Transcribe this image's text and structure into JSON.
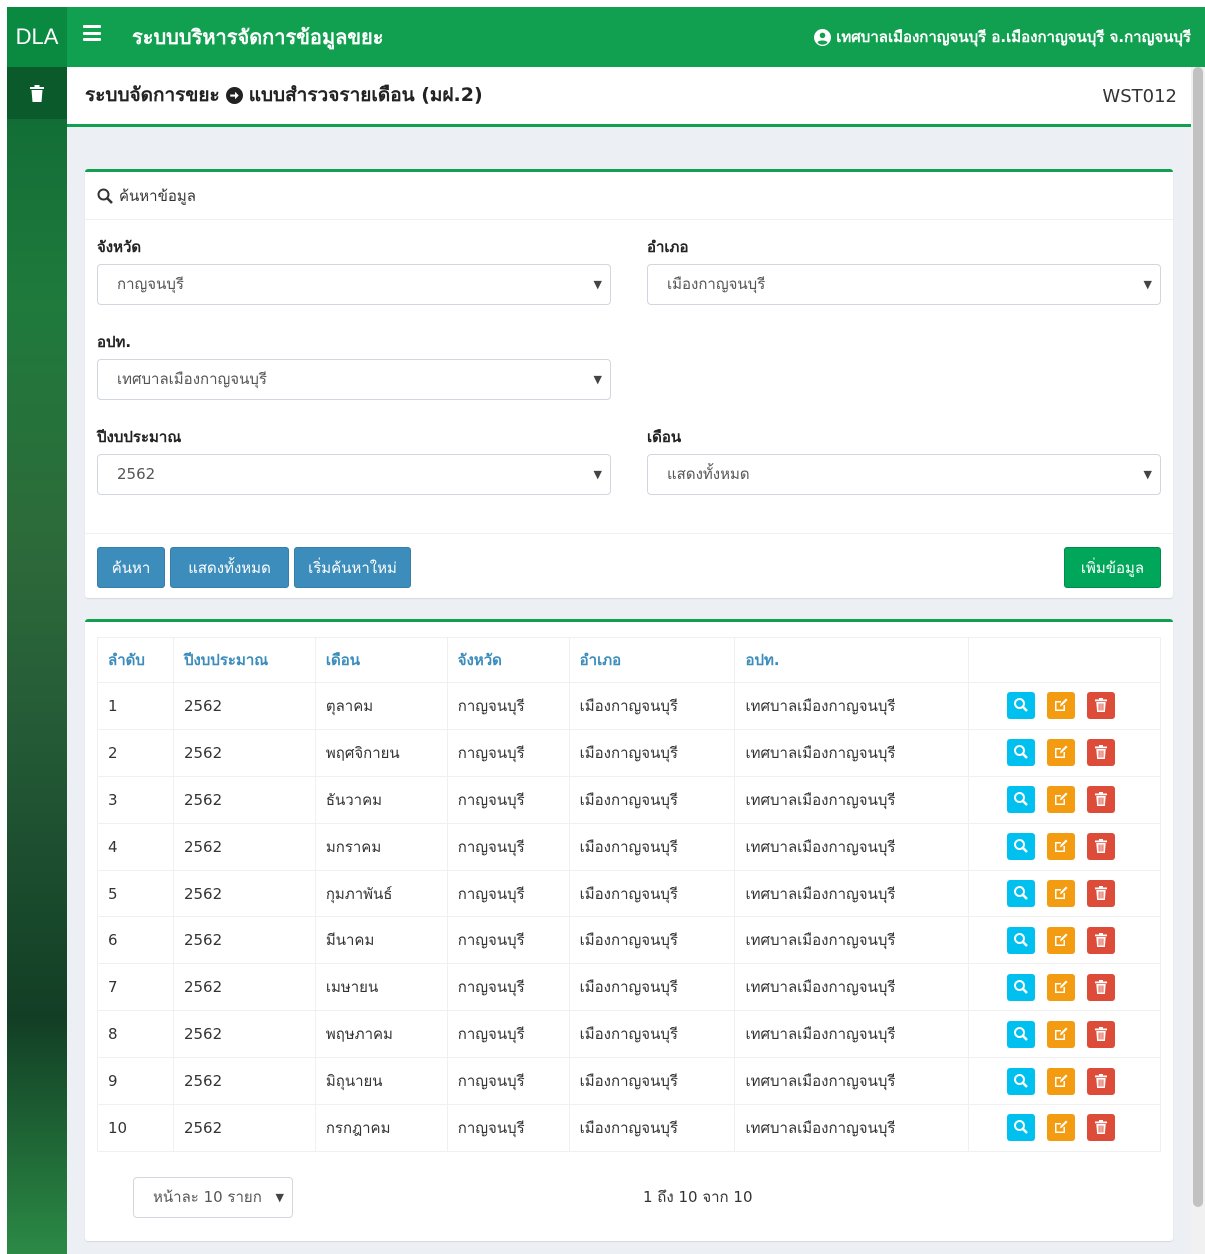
{
  "header": {
    "brand": "DLA",
    "app_title": "ระบบบริหารจัดการข้อมูลขยะ",
    "user": "เทศบาลเมืองกาญจนบุรี อ.เมืองกาญจนบุรี จ.กาญจนบุรี"
  },
  "page": {
    "title_prefix": "ระบบจัดการขยะ",
    "title_suffix": "แบบสำรวจรายเดือน (มฝ.2)",
    "code": "WST012"
  },
  "search": {
    "title": "ค้นหาข้อมูล",
    "province_label": "จังหวัด",
    "province_value": "กาญจนบุรี",
    "district_label": "อำเภอ",
    "district_value": "เมืองกาญจนบุรี",
    "lao_label": "อปท.",
    "lao_value": "เทศบาลเมืองกาญจนบุรี",
    "year_label": "ปีงบประมาณ",
    "year_value": "2562",
    "month_label": "เดือน",
    "month_value": "แสดงทั้งหมด",
    "btn_search": "ค้นหา",
    "btn_show_all": "แสดงทั้งหมด",
    "btn_reset": "เริ่มค้นหาใหม่",
    "btn_add": "เพิ่มข้อมูล"
  },
  "table": {
    "headers": [
      "ลำดับ",
      "ปีงบประมาณ",
      "เดือน",
      "จังหวัด",
      "อำเภอ",
      "อปท."
    ],
    "rows": [
      [
        "1",
        "2562",
        "ตุลาคม",
        "กาญจนบุรี",
        "เมืองกาญจนบุรี",
        "เทศบาลเมืองกาญจนบุรี"
      ],
      [
        "2",
        "2562",
        "พฤศจิกายน",
        "กาญจนบุรี",
        "เมืองกาญจนบุรี",
        "เทศบาลเมืองกาญจนบุรี"
      ],
      [
        "3",
        "2562",
        "ธันวาคม",
        "กาญจนบุรี",
        "เมืองกาญจนบุรี",
        "เทศบาลเมืองกาญจนบุรี"
      ],
      [
        "4",
        "2562",
        "มกราคม",
        "กาญจนบุรี",
        "เมืองกาญจนบุรี",
        "เทศบาลเมืองกาญจนบุรี"
      ],
      [
        "5",
        "2562",
        "กุมภาพันธ์",
        "กาญจนบุรี",
        "เมืองกาญจนบุรี",
        "เทศบาลเมืองกาญจนบุรี"
      ],
      [
        "6",
        "2562",
        "มีนาคม",
        "กาญจนบุรี",
        "เมืองกาญจนบุรี",
        "เทศบาลเมืองกาญจนบุรี"
      ],
      [
        "7",
        "2562",
        "เมษายน",
        "กาญจนบุรี",
        "เมืองกาญจนบุรี",
        "เทศบาลเมืองกาญจนบุรี"
      ],
      [
        "8",
        "2562",
        "พฤษภาคม",
        "กาญจนบุรี",
        "เมืองกาญจนบุรี",
        "เทศบาลเมืองกาญจนบุรี"
      ],
      [
        "9",
        "2562",
        "มิถุนายน",
        "กาญจนบุรี",
        "เมืองกาญจนบุรี",
        "เทศบาลเมืองกาญจนบุรี"
      ],
      [
        "10",
        "2562",
        "กรกฎาคม",
        "กาญจนบุรี",
        "เมืองกาญจนบุรี",
        "เทศบาลเมืองกาญจนบุรี"
      ]
    ],
    "page_size": "หน้าละ 10 รายก",
    "page_info": "1 ถึง 10 จาก 10"
  },
  "colors": {
    "primary_green": "#10a04f",
    "info_blue": "#3c8dbc",
    "view": "#00c0ef",
    "edit": "#f39c12",
    "delete": "#dd4b39"
  },
  "icons": {
    "menu": "hamburger-menu-icon",
    "user": "user-circle-icon",
    "sidebar": "trash-icon",
    "title_separator": "arrow-circle-right-icon",
    "search": "search-icon",
    "view": "search-icon",
    "edit": "edit-icon",
    "delete": "trash-icon"
  }
}
